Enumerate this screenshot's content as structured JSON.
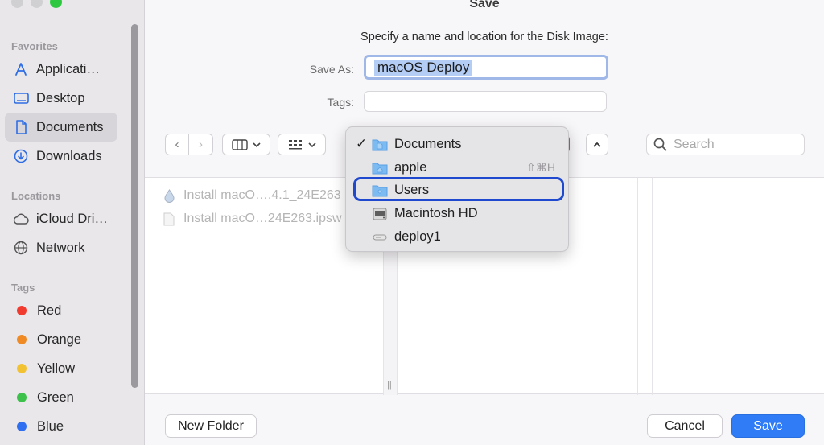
{
  "window": {
    "title": "Save"
  },
  "sidebar": {
    "favorites_heading": "Favorites",
    "favorites": [
      {
        "label": "Applicati…",
        "icon": "applications-icon"
      },
      {
        "label": "Desktop",
        "icon": "desktop-icon"
      },
      {
        "label": "Documents",
        "icon": "document-icon",
        "selected": true
      },
      {
        "label": "Downloads",
        "icon": "downloads-icon"
      }
    ],
    "locations_heading": "Locations",
    "locations": [
      {
        "label": "iCloud Dri…",
        "icon": "cloud-icon"
      },
      {
        "label": "Network",
        "icon": "network-globe-icon"
      }
    ],
    "tags_heading": "Tags",
    "tags": [
      {
        "label": "Red",
        "color": "#f23b2f"
      },
      {
        "label": "Orange",
        "color": "#f08a24"
      },
      {
        "label": "Yellow",
        "color": "#f2c233"
      },
      {
        "label": "Green",
        "color": "#3cc24a"
      },
      {
        "label": "Blue",
        "color": "#2e6ef0"
      }
    ]
  },
  "dialog": {
    "prompt": "Specify a name and location for the Disk Image:",
    "save_as_label": "Save As:",
    "save_as_value": "macOS Deploy",
    "tags_label": "Tags:",
    "search_placeholder": "Search"
  },
  "files": [
    {
      "name": "Install macO….4.1_24E263",
      "icon": "installer-icon"
    },
    {
      "name": "Install macO…24E263.ipsw",
      "icon": "file-icon"
    }
  ],
  "location_menu": {
    "items": [
      {
        "label": "Documents",
        "checked": true,
        "icon": "documents-folder-icon"
      },
      {
        "label": "apple",
        "shortcut": "⇧⌘H",
        "icon": "home-folder-icon"
      },
      {
        "label": "Users",
        "highlighted": true,
        "icon": "users-folder-icon"
      },
      {
        "label": "Macintosh HD",
        "icon": "hard-drive-icon"
      },
      {
        "label": "deploy1",
        "icon": "external-drive-icon"
      }
    ]
  },
  "buttons": {
    "new_folder": "New Folder",
    "cancel": "Cancel",
    "save": "Save"
  },
  "colors": {
    "accent": "#2f7cf6",
    "sidebar_bg": "#e9e7ea",
    "highlight_ring": "#1f49cf"
  }
}
